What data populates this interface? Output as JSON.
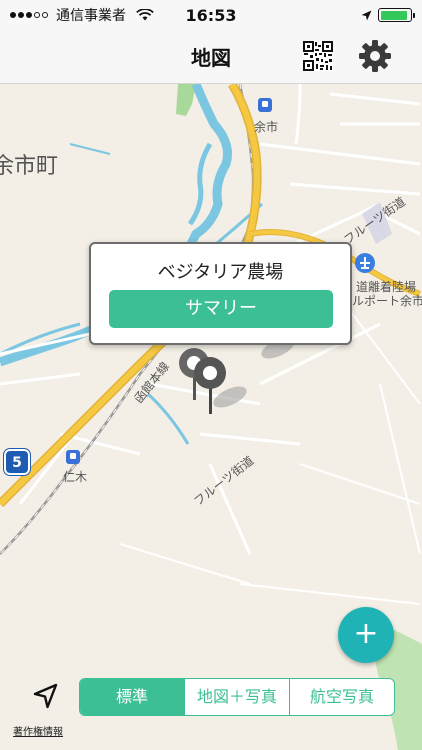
{
  "status_bar": {
    "carrier": "通信事業者",
    "time": "16:53",
    "battery_level": 0.9,
    "battery_color": "#34c759"
  },
  "nav": {
    "title": "地図",
    "qr_icon": "qr-code-icon",
    "settings_icon": "gear-icon"
  },
  "map": {
    "labels": {
      "town": "余市町",
      "station_yoichi": "余市",
      "station_niki": "仁木",
      "road_fruit_upper": "フルーツ街道",
      "road_fruit_lower": "フルーツ街道",
      "rail_line": "函館本線",
      "airport_line1": "道離着陸場",
      "airport_line2": "ルポート余市",
      "route_number": "5"
    },
    "callout": {
      "name": "ベジタリア農場",
      "summary_button": "サマリー"
    }
  },
  "fab": {
    "label": "+"
  },
  "bottom": {
    "credits": "著作権情報",
    "locate_icon": "location-arrow-icon",
    "map_types": [
      "標準",
      "地図＋写真",
      "航空写真"
    ],
    "selected_map_type": "標準"
  },
  "colors": {
    "accent": "#3dbf96",
    "fab": "#1fb3b5",
    "water": "#7bc6e0",
    "road_major": "#f5c842"
  }
}
